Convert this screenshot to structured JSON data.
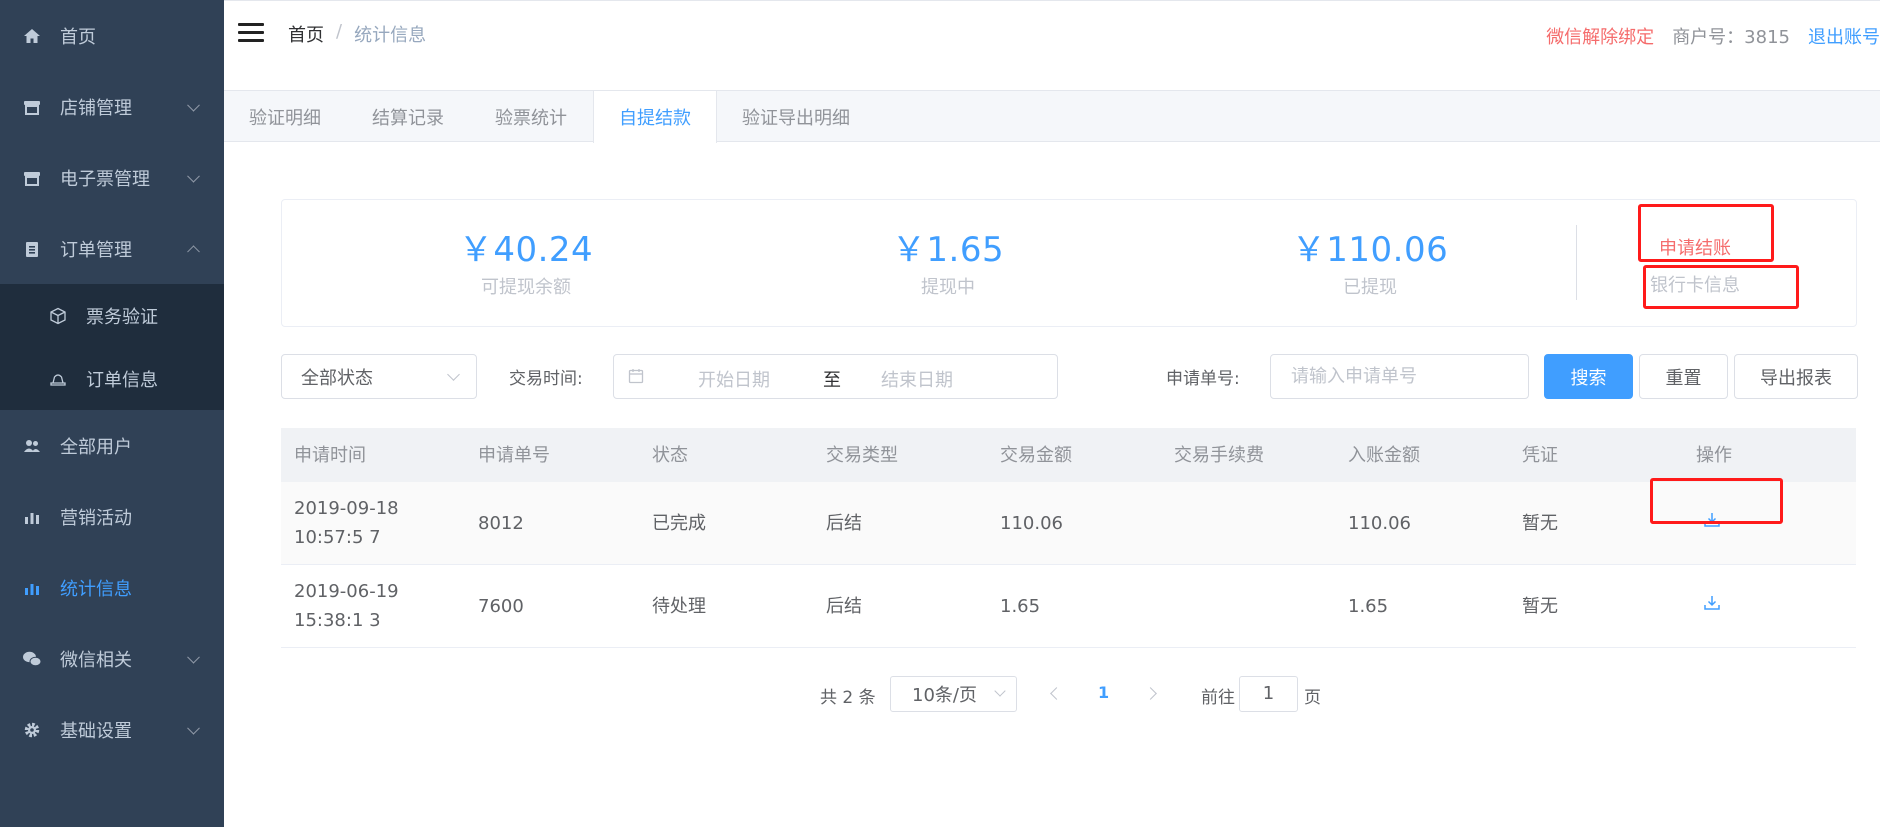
{
  "sidebar": {
    "items": [
      {
        "label": "首页",
        "icon": "home-icon"
      },
      {
        "label": "店铺管理",
        "icon": "store-icon"
      },
      {
        "label": "电子票管理",
        "icon": "ticket-store-icon"
      },
      {
        "label": "订单管理",
        "icon": "clipboard-icon"
      },
      {
        "label": "票务验证",
        "icon": "cube-icon"
      },
      {
        "label": "订单信息",
        "icon": "bell-icon"
      },
      {
        "label": "全部用户",
        "icon": "users-icon"
      },
      {
        "label": "营销活动",
        "icon": "chart-icon"
      },
      {
        "label": "统计信息",
        "icon": "chart-icon"
      },
      {
        "label": "微信相关",
        "icon": "wechat-icon"
      },
      {
        "label": "基础设置",
        "icon": "gear-icon"
      }
    ],
    "active": "统计信息"
  },
  "header": {
    "breadcrumb": [
      "首页",
      "/",
      "统计信息"
    ],
    "unbind": "微信解除绑定",
    "merchant": "商户号：3815",
    "logout": "退出账号"
  },
  "tabs": [
    "验证明细",
    "结算记录",
    "验票统计",
    "自提结款",
    "验证导出明细"
  ],
  "active_tab": "自提结款",
  "summary": {
    "stats": [
      {
        "amount": "￥40.24",
        "label": "可提现余额"
      },
      {
        "amount": "￥1.65",
        "label": "提现中"
      },
      {
        "amount": "￥110.06",
        "label": "已提现"
      }
    ],
    "apply": "申请结账",
    "bank": "银行卡信息"
  },
  "filters": {
    "status": "全部状态",
    "time_label": "交易时间:",
    "start_placeholder": "开始日期",
    "to": "至",
    "end_placeholder": "结束日期",
    "order_label": "申请单号:",
    "order_placeholder": "请输入申请单号",
    "search": "搜索",
    "reset": "重置",
    "export": "导出报表"
  },
  "table": {
    "headers": [
      "申请时间",
      "申请单号",
      "状态",
      "交易类型",
      "交易金额",
      "交易手续费",
      "入账金额",
      "凭证",
      "操作"
    ],
    "rows": [
      {
        "time": "2019-09-18 10:57:5 7",
        "no": "8012",
        "status": "已完成",
        "type": "后结",
        "amount": "110.06",
        "fee": "",
        "credited": "110.06",
        "voucher": "暂无"
      },
      {
        "time": "2019-06-19 15:38:1 3",
        "no": "7600",
        "status": "待处理",
        "type": "后结",
        "amount": "1.65",
        "fee": "",
        "credited": "1.65",
        "voucher": "暂无"
      }
    ]
  },
  "pagination": {
    "total": "共 2 条",
    "page_size": "10条/页",
    "current": "1",
    "goto": "前往",
    "goto_value": "1",
    "page_suffix": "页"
  },
  "colors": {
    "accent": "#409eff",
    "danger": "#f56c6c",
    "sidebar": "#304156",
    "annotation": "#ff1a1a"
  }
}
